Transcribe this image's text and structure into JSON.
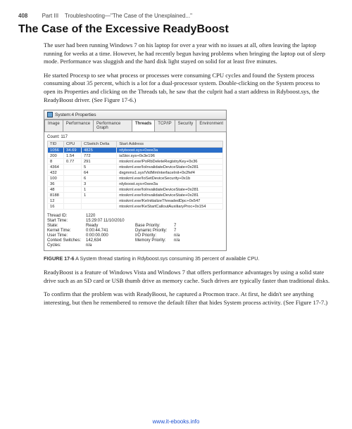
{
  "header": {
    "page_number": "408",
    "part_label": "Part III",
    "part_title": "Troubleshooting—\"The Case of the Unexplained...\""
  },
  "title": "The Case of the Excessive ReadyBoost",
  "paragraphs": {
    "p1": "The user had been running Windows 7 on his laptop for over a year with no issues at all, often leaving the laptop running for weeks at a time. However, he had recently begun having problems when bringing the laptop out of sleep mode. Performance was sluggish and the hard disk light stayed on solid for at least five minutes.",
    "p2": "He started Procexp to see what process or processes were consuming CPU cycles and found the System process consuming about 35 percent, which is a lot for a dual-processor system. Double-clicking on the System process to open its Properties and clicking on the Threads tab, he saw that the culprit had a start address in Rdyboost.sys, the ReadyBoost driver. (See Figure 17-6.)",
    "p3": "ReadyBoost is a feature of Windows Vista and Windows 7 that offers performance advantages by using a solid state drive such as an SD card or USB thumb drive as memory cache. Such drives are typically faster than traditional disks.",
    "p4": "To confirm that the problem was with ReadyBoost, he captured a Procmon trace. At first, he didn't see anything interesting, but then he remembered to remove the default filter that hides System process activity. (See Figure 17-7.)"
  },
  "window": {
    "title": "System:4 Properties",
    "tabs": [
      "Image",
      "Performance",
      "Performance Graph",
      "Threads",
      "TCP/IP",
      "Security",
      "Environment"
    ],
    "active_tab": "Threads",
    "count_label": "Count:",
    "count_value": "117",
    "columns": [
      "TID",
      "CPU",
      "CSwitch Delta",
      "Start Address"
    ],
    "rows": [
      {
        "tid": "1056",
        "cpu": "34.69",
        "cs": "4825",
        "addr": "rdyboost.sys+0xee3a",
        "selected": true
      },
      {
        "tid": "200",
        "cpu": "1.54",
        "cs": "772",
        "addr": "iaStor.sys+0x3e196"
      },
      {
        "tid": "8",
        "cpu": "0.77",
        "cs": "291",
        "addr": "ntoskrnl.exe!PoRbDeleteRegistryKey+0x36"
      },
      {
        "tid": "4364",
        "cpu": "",
        "cs": "5",
        "addr": "ntoskrnl.exe!IoInvalidateDeviceState+0x281"
      },
      {
        "tid": "432",
        "cpu": "",
        "cs": "64",
        "addr": "dxgmms1.sys!VidMmInterfaceInit+0x2fef4"
      },
      {
        "tid": "100",
        "cpu": "",
        "cs": "6",
        "addr": "ntoskrnl.exe!IoSetDeviceSecurity+0x1b"
      },
      {
        "tid": "36",
        "cpu": "",
        "cs": "3",
        "addr": "rdyboost.sys+0xee3a"
      },
      {
        "tid": "48",
        "cpu": "",
        "cs": "1",
        "addr": "ntoskrnl.exe!IoInvalidateDeviceState+0x281"
      },
      {
        "tid": "8188",
        "cpu": "",
        "cs": "1",
        "addr": "ntoskrnl.exe!IoInvalidateDeviceState+0x281"
      },
      {
        "tid": "12",
        "cpu": "",
        "cs": "",
        "addr": "ntoskrnl.exe!KeInitializeThreadedDpc+0x547"
      },
      {
        "tid": "16",
        "cpu": "",
        "cs": "",
        "addr": "ntoskrnl.exe!KeStartCalloutAuxiliaryProc+0x154"
      }
    ],
    "details": {
      "thread_id_label": "Thread ID:",
      "thread_id": "1220",
      "start_time_label": "Start Time:",
      "start_time": "15:29:07 11/10/2010",
      "state_label": "State:",
      "state": "Ready",
      "base_priority_label": "Base Priority:",
      "base_priority": "7",
      "kernel_time_label": "Kernel Time:",
      "kernel_time": "0:00:44.741",
      "dynamic_priority_label": "Dynamic Priority:",
      "dynamic_priority": "7",
      "user_time_label": "User Time:",
      "user_time": "0:00:00.000",
      "io_priority_label": "I/O Priority:",
      "io_priority": "n/a",
      "context_switches_label": "Context Switches:",
      "context_switches": "142,634",
      "memory_priority_label": "Memory Priority:",
      "memory_priority": "n/a",
      "cycles_label": "Cycles:",
      "cycles": "n/a"
    }
  },
  "caption": {
    "label": "FIGURE 17-6",
    "text": "A System thread starting in Rdyboost.sys consuming 35 percent of available CPU."
  },
  "footer_link": "www.it-ebooks.info"
}
